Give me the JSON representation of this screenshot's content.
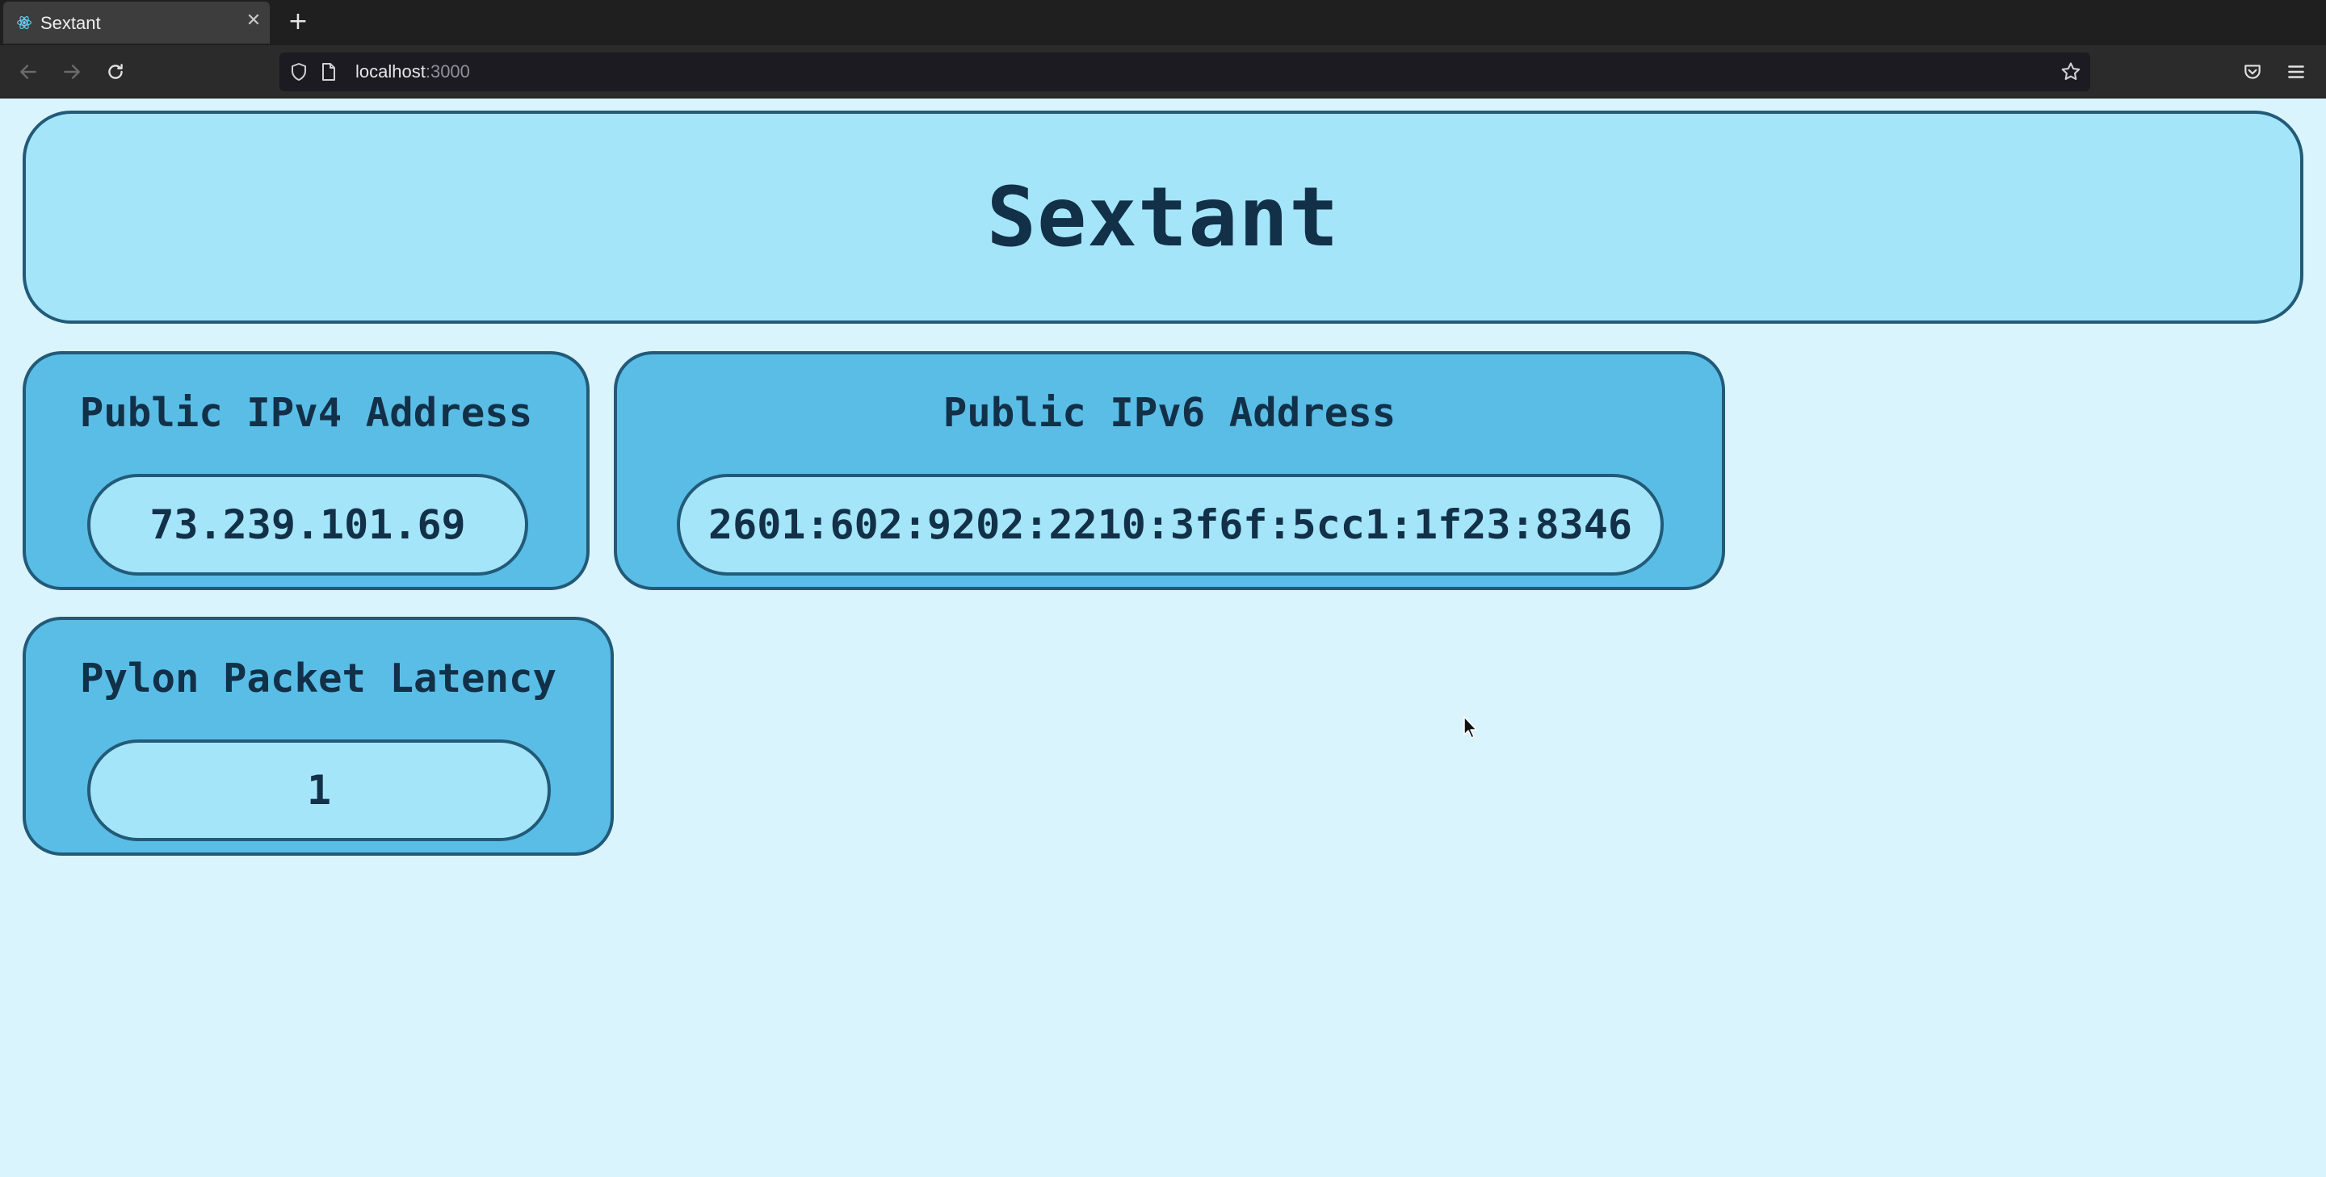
{
  "browser": {
    "tab_title": "Sextant",
    "url_host": "localhost",
    "url_port": ":3000"
  },
  "header": {
    "title": "Sextant"
  },
  "cards": {
    "ipv4": {
      "title": "Public IPv4 Address",
      "value": "73.239.101.69"
    },
    "ipv6": {
      "title": "Public IPv6 Address",
      "value": "2601:602:9202:2210:3f6f:5cc1:1f23:8346"
    },
    "latency": {
      "title": "Pylon Packet Latency",
      "value": "1"
    }
  },
  "colors": {
    "page_bg": "#d9f4fd",
    "header_bg": "#a4e5fa",
    "card_bg": "#5abde6",
    "border": "#225a78",
    "text": "#123047"
  },
  "icons": {
    "tab_favicon": "react-icon",
    "back": "arrow-left-icon",
    "forward": "arrow-right-icon",
    "reload": "reload-icon",
    "tracking": "shield-icon",
    "page": "page-icon",
    "bookmark": "star-icon",
    "pocket": "pocket-icon",
    "menu": "hamburger-menu-icon"
  }
}
